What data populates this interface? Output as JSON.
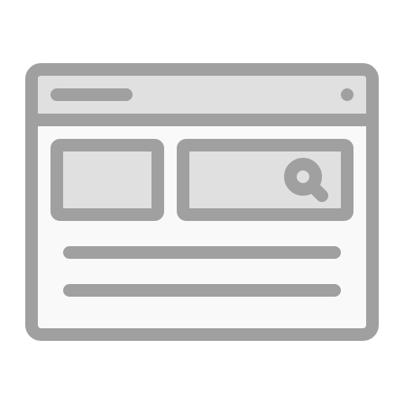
{
  "icon": {
    "name": "web-browser-search-icon",
    "description_visible_text": ""
  },
  "colors": {
    "stroke": "#a0a0a0",
    "header_fill": "#e0e0e0",
    "window_fill": "#f9f9f9",
    "panel_fill": "#e0e0e0",
    "background": "#ffffff"
  },
  "icons": {
    "window_dot": "circle-dot-icon",
    "search": "search-icon"
  }
}
